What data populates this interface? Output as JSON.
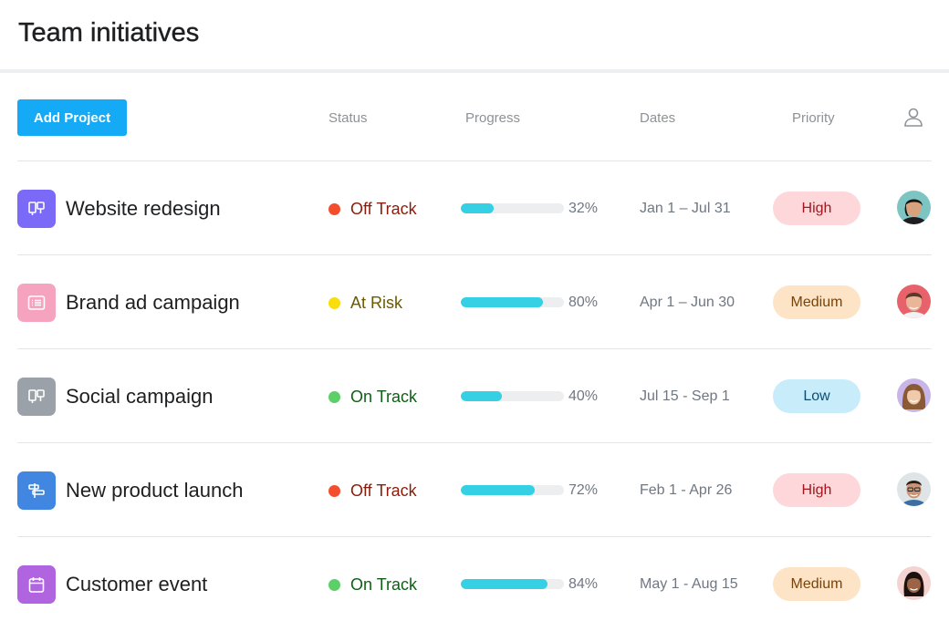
{
  "page": {
    "title": "Team initiatives"
  },
  "toolbar": {
    "add_label": "Add Project",
    "columns": {
      "status": "Status",
      "progress": "Progress",
      "dates": "Dates",
      "priority": "Priority"
    },
    "assignee_icon": "person-icon"
  },
  "colors": {
    "accent": "#14aaf5",
    "off_track": "#f44d2e",
    "at_risk": "#f8de0c",
    "on_track": "#5bd068",
    "progress_fill": "#35d0e3"
  },
  "projects": [
    {
      "name": "Website redesign",
      "icon": "board-icon",
      "icon_color": "#7b6af7",
      "status": "Off Track",
      "status_color": "#f44d2e",
      "status_text_color": "#8a1c0c",
      "progress": 0.32,
      "progress_label": "32%",
      "dates": "Jan 1 – Jul 31",
      "priority": "High",
      "priority_bg": "#fdd7d9",
      "priority_color": "#a2161f",
      "avatar": "avatar-1"
    },
    {
      "name": "Brand ad campaign",
      "icon": "list-icon",
      "icon_color": "#f6a3c0",
      "status": "At Risk",
      "status_color": "#f8de0c",
      "status_text_color": "#6b5a00",
      "progress": 0.8,
      "progress_label": "80%",
      "dates": "Apr 1 – Jun 30",
      "priority": "Medium",
      "priority_bg": "#fde4c6",
      "priority_color": "#7a4308",
      "avatar": "avatar-2"
    },
    {
      "name": "Social campaign",
      "icon": "board-icon",
      "icon_color": "#9ba1a9",
      "status": "On Track",
      "status_color": "#5bd068",
      "status_text_color": "#0f5e16",
      "progress": 0.4,
      "progress_label": "40%",
      "dates": "Jul 15 - Sep 1",
      "priority": "Low",
      "priority_bg": "#c9ecfb",
      "priority_color": "#0c4e73",
      "avatar": "avatar-3"
    },
    {
      "name": "New product launch",
      "icon": "timeline-icon",
      "icon_color": "#4186e0",
      "status": "Off Track",
      "status_color": "#f44d2e",
      "status_text_color": "#8a1c0c",
      "progress": 0.72,
      "progress_label": "72%",
      "dates": "Feb 1 - Apr 26",
      "priority": "High",
      "priority_bg": "#fdd7d9",
      "priority_color": "#a2161f",
      "avatar": "avatar-4"
    },
    {
      "name": "Customer event",
      "icon": "calendar-icon",
      "icon_color": "#b064e0",
      "status": "On Track",
      "status_color": "#5bd068",
      "status_text_color": "#0f5e16",
      "progress": 0.84,
      "progress_label": "84%",
      "dates": "May 1 - Aug 15",
      "priority": "Medium",
      "priority_bg": "#fde4c6",
      "priority_color": "#7a4308",
      "avatar": "avatar-5"
    }
  ]
}
